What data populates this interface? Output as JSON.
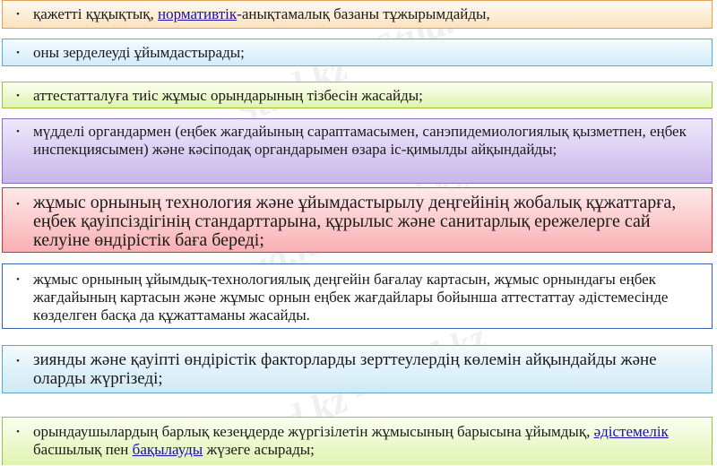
{
  "watermark": "Stud.kz - Stud.kz",
  "bullet": "•",
  "items": [
    {
      "parts": [
        {
          "text": "қажетті құқықтық, "
        },
        {
          "text": "нормативтік",
          "link": true
        },
        {
          "text": "-анықтамалық базаны тұжырымдайды,"
        }
      ]
    },
    {
      "parts": [
        {
          "text": "оны зерделеуді ұйымдастырады;"
        }
      ]
    },
    {
      "parts": [
        {
          "text": "аттестатталуға тиіс жұмыс орындарының тізбесін жасайды;"
        }
      ]
    },
    {
      "parts": [
        {
          "text": "мүдделі органдармен (еңбек жағдайының сараптамасымен, санэпидемиологиялық қызметпен, еңбек инспекциясымен) және кәсіподақ органдарымен өзара іс-қимылды айқындайды;"
        }
      ]
    },
    {
      "parts": [
        {
          "text": "жұмыс орнының технология және ұйымдастырылу деңгейінің жобалық құжаттарға, еңбек қауіпсіздігінің стандарттарына, құрылыс және санитарлық ережелерге сай келуіне өндірістік баға береді;"
        }
      ]
    },
    {
      "parts": [
        {
          "text": "жұмыс орнының ұйымдық-технологиялық деңгейін бағалау картасын, жұмыс орнындағы еңбек жағдайының картасын және жұмыс орнын еңбек жағдайлары бойынша аттестаттау әдістемесінде көзделген басқа да құжаттаманы жасайды."
        }
      ]
    },
    {
      "parts": [
        {
          "text": "зиянды және қауіпті өндірістік факторларды зерттеулердің көлемін айқындайды және оларды жүргізеді;"
        }
      ]
    },
    {
      "parts": [
        {
          "text": "орындаушылардың барлық кезеңдерде жүргізілетін жұмысының барысына ұйымдық, "
        },
        {
          "text": "әдістемелік",
          "link": true
        },
        {
          "text": " басшылық пен "
        },
        {
          "text": "бақылауды",
          "link": true
        },
        {
          "text": " жүзеге асырады;"
        }
      ]
    }
  ]
}
